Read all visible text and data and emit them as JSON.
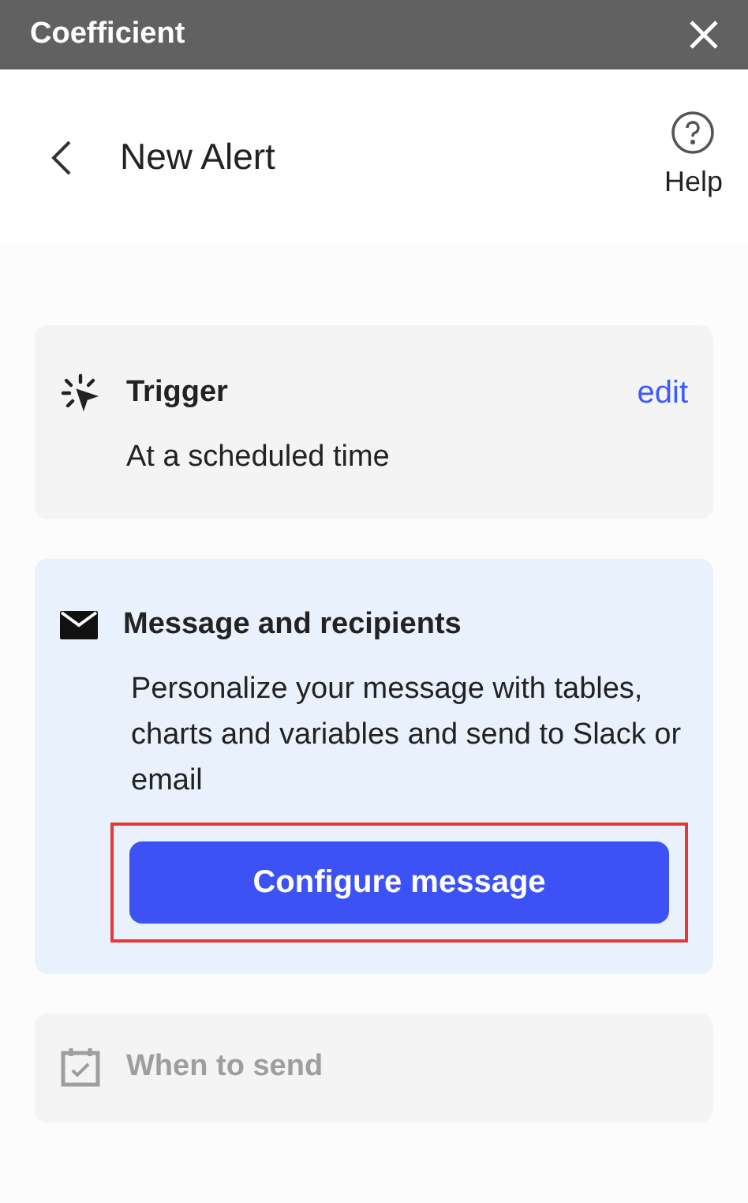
{
  "title_bar": {
    "title": "Coefficient"
  },
  "header": {
    "title": "New Alert",
    "help_label": "Help"
  },
  "steps": [
    {
      "kind": "done",
      "title": "Trigger",
      "action": "edit",
      "detail": "At a scheduled time"
    },
    {
      "kind": "active",
      "title": "Message and recipients",
      "detail": "Personalize your message with tables, charts and variables and send to Slack or email",
      "button": {
        "label": "Configure message",
        "highlighted": true
      }
    },
    {
      "kind": "disabled",
      "title": "When to send"
    }
  ]
}
